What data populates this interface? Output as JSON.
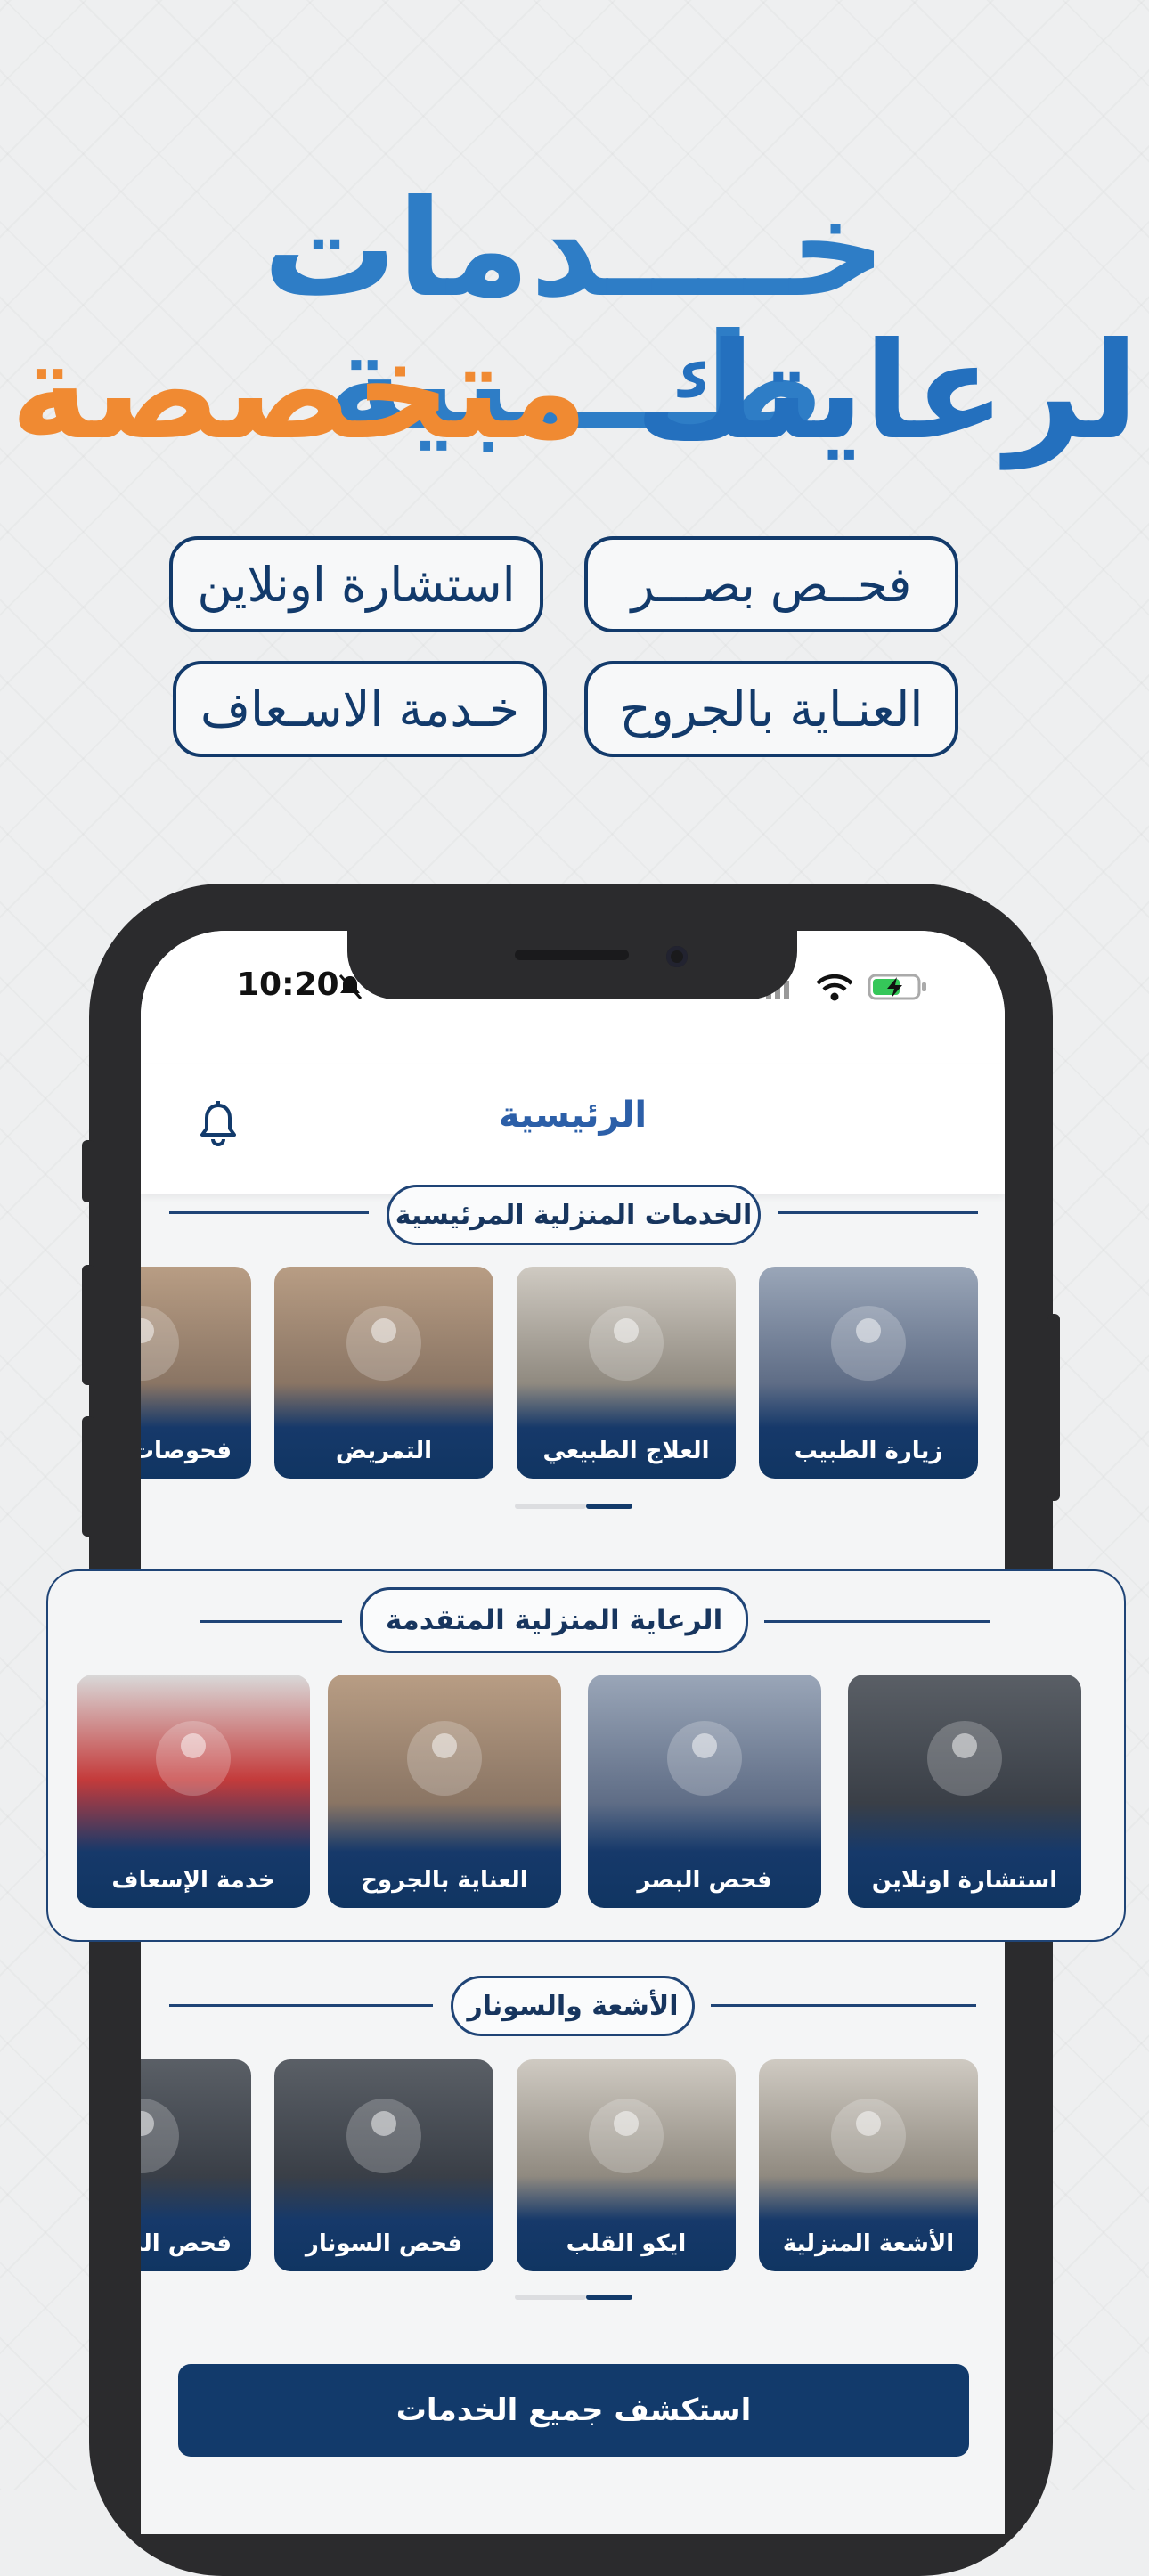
{
  "hero": {
    "line1": "خــــدمات طــــبية",
    "line2_orange": "متخصصة",
    "line2_blue": "لرعايتك"
  },
  "pills": [
    "فحــص بصـــر",
    "استشارة اونلاين",
    "العنـاية بالجروح",
    "خـدمة الاسـعاف"
  ],
  "status_bar": {
    "time": "10:20"
  },
  "app_header": {
    "title": "الرئيسية",
    "bell_icon": "bell-icon"
  },
  "main_services": {
    "title": "الخدمات المنزلية المرئيسية",
    "cards": [
      "زيارة الطبيب",
      "العلاج الطبيعي",
      "التمريض",
      "فحوصات"
    ]
  },
  "advanced_care": {
    "title": "الرعاية المنزلية المتقدمة",
    "cards": [
      "استشارة اونلاين",
      "فحص البصر",
      "العناية بالجروح",
      "خدمة الإسعاف"
    ]
  },
  "radiology": {
    "title": "الأشعة والسونار",
    "cards": [
      "الأشعة المنزلية",
      "ايكو القلب",
      "فحص السونار",
      "فحص الد"
    ]
  },
  "cta": {
    "label": "استكشف جميع الخدمات"
  },
  "colors": {
    "brand_blue": "#2e7dc6",
    "brand_orange": "#f08a32",
    "navy": "#123a6b"
  }
}
